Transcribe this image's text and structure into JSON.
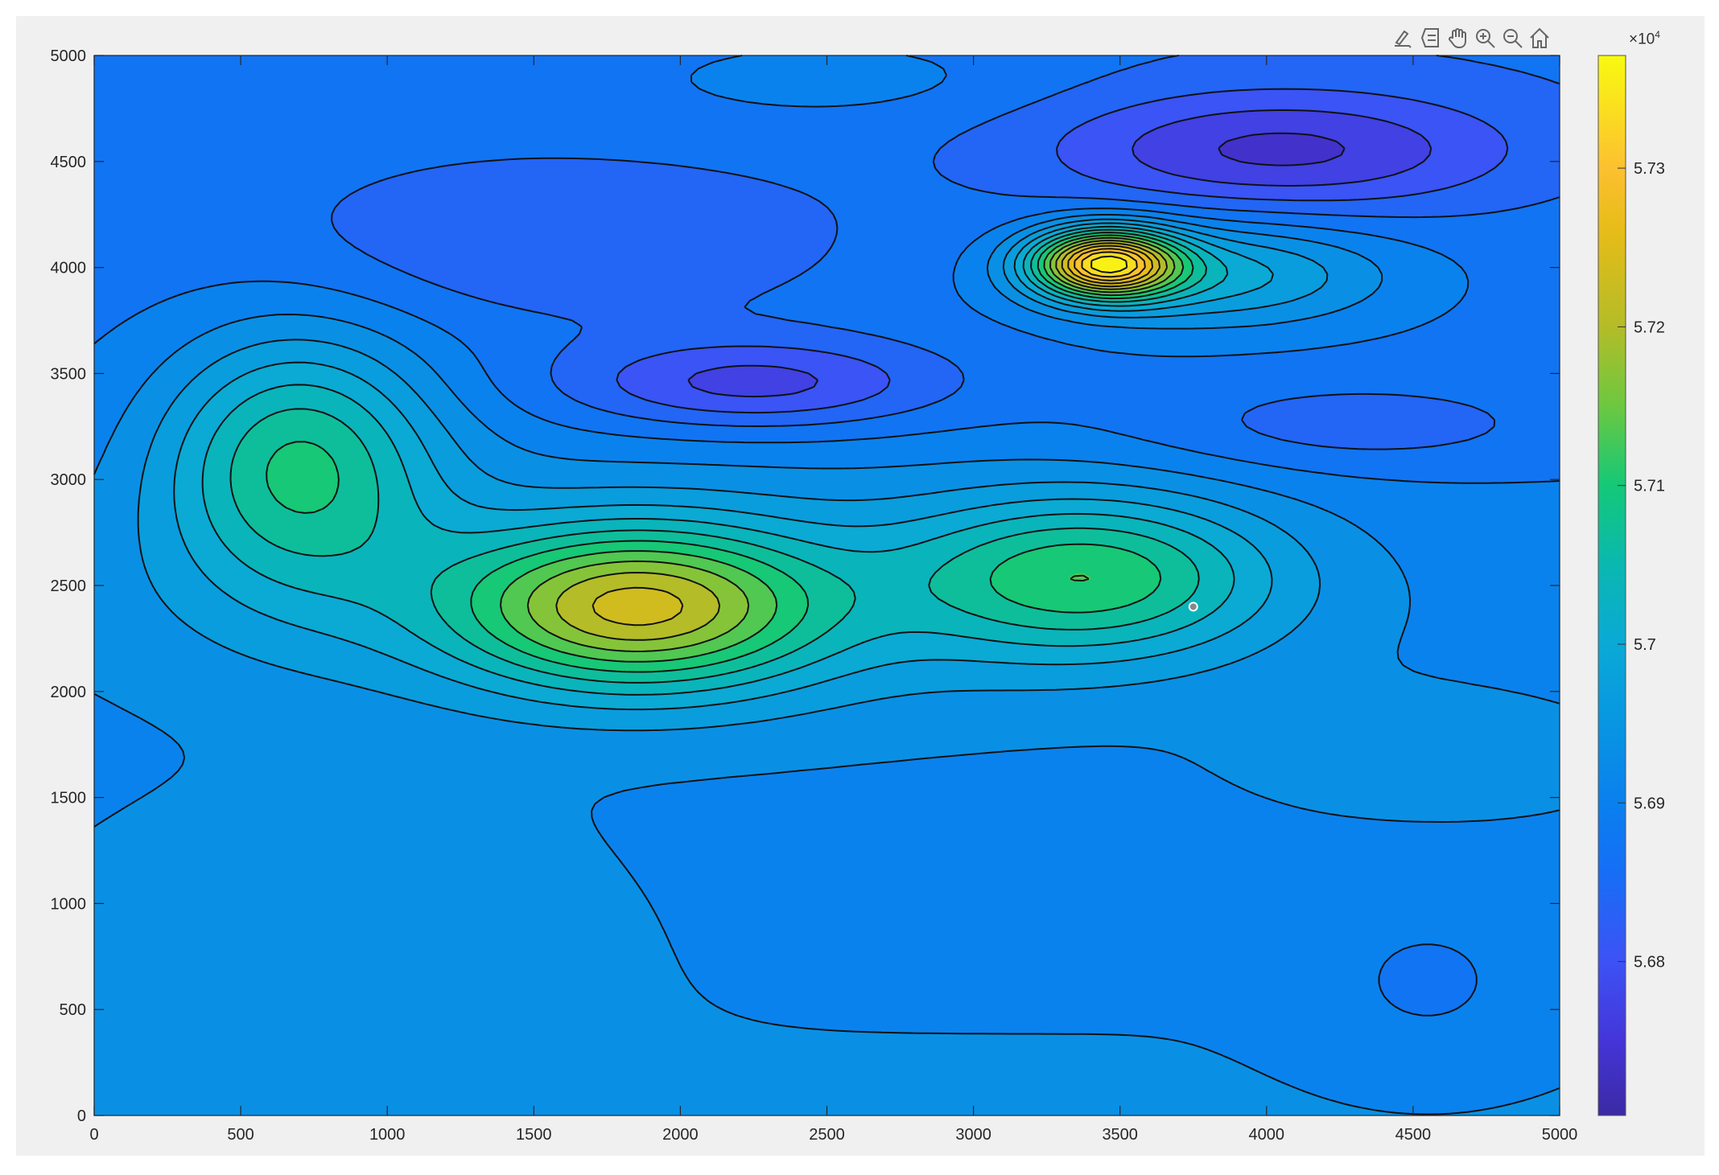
{
  "toolbar": {
    "icons": [
      "brush-icon",
      "data-tips-icon",
      "pan-hand-icon",
      "zoom-in-icon",
      "zoom-out-icon",
      "home-icon"
    ]
  },
  "chart_data": {
    "type": "contour",
    "title": "",
    "xlabel": "",
    "ylabel": "",
    "xlim": [
      0,
      5000
    ],
    "ylim": [
      0,
      5000
    ],
    "xticks": [
      0,
      500,
      1000,
      1500,
      2000,
      2500,
      3000,
      3500,
      4000,
      4500,
      5000
    ],
    "yticks": [
      0,
      500,
      1000,
      1500,
      2000,
      2500,
      3000,
      3500,
      4000,
      4500,
      5000
    ],
    "xtick_labels": [
      "0",
      "500",
      "1000",
      "1500",
      "2000",
      "2500",
      "3000",
      "3500",
      "4000",
      "4500",
      "5000"
    ],
    "ytick_labels": [
      "0",
      "500",
      "1000",
      "1500",
      "2000",
      "2500",
      "3000",
      "3500",
      "4000",
      "4500",
      "5000"
    ],
    "colorbar": {
      "exponent_label": "×10",
      "exponent": "4",
      "clim": [
        5.6703,
        5.7371
      ],
      "ticks": [
        5.68,
        5.69,
        5.7,
        5.71,
        5.72,
        5.73
      ],
      "tick_labels": [
        "5.68",
        "5.69",
        "5.7",
        "5.71",
        "5.72",
        "5.73"
      ],
      "colormap": [
        {
          "v": 5.6703,
          "c": "#3b2aa3"
        },
        {
          "v": 5.675,
          "c": "#4435d8"
        },
        {
          "v": 5.68,
          "c": "#3d52f5"
        },
        {
          "v": 5.686,
          "c": "#1470f5"
        },
        {
          "v": 5.69,
          "c": "#0a80ee"
        },
        {
          "v": 5.695,
          "c": "#0896e2"
        },
        {
          "v": 5.7,
          "c": "#0aa9d6"
        },
        {
          "v": 5.705,
          "c": "#0ab8b0"
        },
        {
          "v": 5.71,
          "c": "#14c878"
        },
        {
          "v": 5.715,
          "c": "#6cc840"
        },
        {
          "v": 5.72,
          "c": "#b4bc28"
        },
        {
          "v": 5.726,
          "c": "#e6bc18"
        },
        {
          "v": 5.73,
          "c": "#fcc030"
        },
        {
          "v": 5.7371,
          "c": "#f8fa10"
        }
      ]
    },
    "levels": {
      "start": 5.6722,
      "step": 0.0033,
      "count": 20
    },
    "field_model": {
      "base": 5.6925,
      "slope_per_unit_y": -1.3e-06,
      "bumps": [
        {
          "x": 700,
          "y": 3100,
          "amp": 0.019,
          "sx": 330,
          "sy": 420
        },
        {
          "x": 1850,
          "y": 2400,
          "amp": 0.026,
          "sx": 430,
          "sy": 260
        },
        {
          "x": 3400,
          "y": 2550,
          "amp": 0.0175,
          "sx": 430,
          "sy": 260
        },
        {
          "x": 2000,
          "y": 2450,
          "amp": 0.008,
          "sx": 1500,
          "sy": 450
        },
        {
          "x": 3450,
          "y": 4020,
          "amp": 0.042,
          "sx": 170,
          "sy": 110
        },
        {
          "x": 3800,
          "y": 3970,
          "amp": 0.013,
          "sx": 420,
          "sy": 170
        },
        {
          "x": 4050,
          "y": 4550,
          "amp": -0.012,
          "sx": 550,
          "sy": 200
        },
        {
          "x": 2250,
          "y": 3450,
          "amp": -0.011,
          "sx": 450,
          "sy": 150
        },
        {
          "x": 1600,
          "y": 4100,
          "amp": -0.005,
          "sx": 650,
          "sy": 250
        },
        {
          "x": 4300,
          "y": 3250,
          "amp": -0.005,
          "sx": 500,
          "sy": 150
        },
        {
          "x": 800,
          "y": 1000,
          "amp": 0.004,
          "sx": 600,
          "sy": 400
        },
        {
          "x": 4550,
          "y": 600,
          "amp": -0.0035,
          "sx": 300,
          "sy": 300
        },
        {
          "x": 4600,
          "y": 1700,
          "amp": 0.0045,
          "sx": 450,
          "sy": 200
        },
        {
          "x": 2500,
          "y": 4900,
          "amp": 0.004,
          "sx": 500,
          "sy": 150
        }
      ]
    },
    "marker": {
      "x": 3750,
      "y": 2400
    }
  }
}
